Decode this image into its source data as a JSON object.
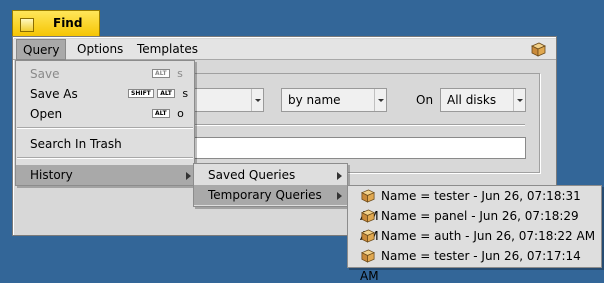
{
  "window": {
    "title": "Find"
  },
  "menubar": {
    "items": [
      "Query",
      "Options",
      "Templates"
    ],
    "active_index": 0
  },
  "query_menu": {
    "items": [
      {
        "label": "Save",
        "shortcut_mods": [
          "ALT"
        ],
        "shortcut_key": "s",
        "disabled": true
      },
      {
        "label": "Save As",
        "shortcut_mods": [
          "SHIFT",
          "ALT"
        ],
        "shortcut_key": "s",
        "disabled": false
      },
      {
        "label": "Open",
        "shortcut_mods": [
          "ALT"
        ],
        "shortcut_key": "o",
        "disabled": false
      },
      {
        "label": "Search In Trash"
      },
      {
        "label": "History",
        "has_submenu": true,
        "selected": true
      }
    ]
  },
  "history_submenu": {
    "items": [
      {
        "label": "Saved Queries",
        "has_submenu": true
      },
      {
        "label": "Temporary Queries",
        "has_submenu": true,
        "selected": true
      }
    ]
  },
  "temporary_queries": {
    "items": [
      "Name = tester - Jun 26, 07:18:31 AM",
      "Name = panel - Jun 26, 07:18:29 AM",
      "Name = auth - Jun 26, 07:18:22 AM",
      "Name = tester - Jun 26, 07:17:14 AM"
    ],
    "item_icon": "query-package-icon"
  },
  "form": {
    "search_mode": "by name",
    "on_label": "On",
    "volume": "All disks",
    "query_text": ""
  },
  "colors": {
    "desktop": "#336698",
    "tab": "#f5c400",
    "menu_selected": "#a9a9a9"
  }
}
